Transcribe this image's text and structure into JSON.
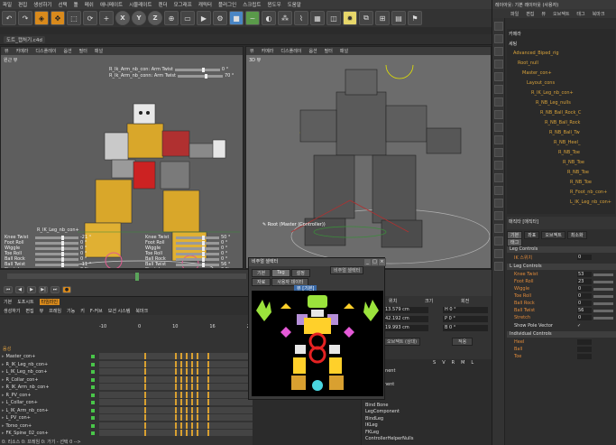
{
  "menubar": [
    "파일",
    "편집",
    "생성하기",
    "선택",
    "툴",
    "메쉬",
    "애니메이트",
    "시뮬레이트",
    "렌더",
    "모그래프",
    "캐릭터",
    "플러그인",
    "스크립트",
    "윈도우",
    "도움말"
  ],
  "toolbar": {
    "xyz": [
      "X",
      "Y",
      "Z"
    ],
    "icons": [
      "undo-icon",
      "redo-icon",
      "select-icon",
      "move-icon",
      "scale-icon",
      "rotate-icon"
    ]
  },
  "path_tab": "도트_캡처기.c4d",
  "viewport_left": {
    "menu": [
      "뷰",
      "카메라",
      "디스플레이",
      "옵션",
      "필터",
      "패널"
    ],
    "label": "원근 뷰",
    "top_controls": [
      "R_Ik_Arm_nb_con: Arm Twist",
      "R_Ik_Arm_nb_conn: Arm Twist"
    ],
    "top_values": [
      "0 °",
      "70 °"
    ],
    "bottom_header": "R_IK_Leg_nb_con+",
    "bottom_controls": [
      "Knee Twist",
      "Foot Roll",
      "Wiggle",
      "Toe Roll",
      "Ball Rock",
      "Ball Twist",
      "Stretch"
    ],
    "bottom_values": [
      "-21 °",
      "0 °",
      "0 °",
      "0 °",
      "0 °",
      "-11 °",
      "0 %"
    ],
    "bottom_controls_right": [
      "Knee Twist",
      "Foot Roll",
      "Wiggle",
      "Toe Roll",
      "Ball Rock",
      "Ball Twist",
      "Stretch"
    ],
    "bottom_values_right": [
      "50 °",
      "0 °",
      "0 °",
      "0 °",
      "0 °",
      "56 °",
      "0 %"
    ]
  },
  "viewport_right": {
    "menu": [
      "뷰",
      "카메라",
      "디스플레이",
      "옵션",
      "필터",
      "패널"
    ],
    "label": "3D 뷰",
    "tooltip": "Root (Master (Controller))"
  },
  "dopesheet": {
    "tabs": [
      "기본",
      "도프시트",
      "타임라인"
    ],
    "menu": [
      "생성하기",
      "편집",
      "뷰",
      "프레임",
      "기능",
      "키",
      "F-커브",
      "모션 시스템",
      "북마크"
    ],
    "header": "음성",
    "rows": [
      "Master_con+",
      "R_IK_Leg_nb_con+",
      "L_IK_Leg_nb_con+",
      "R_Collar_con+",
      "R_IK_Arm_nb_con+",
      "R_PV_con+",
      "L_Collar_con+",
      "L_IK_Arm_nb_con+",
      "L_PV_con+",
      "Torso_con+",
      "FK_Spine_02_con+"
    ],
    "ruler": [
      "-10",
      "0",
      "10",
      "16",
      "24"
    ],
    "status": "0: 리소스 0: 프레임 0: 가기 - 선택 0 -->"
  },
  "visual_selector": {
    "title": "비주얼 셀렉터",
    "dropdown": "비주얼 셀렉터",
    "tabs": [
      "기본",
      "Tag",
      "설정"
    ],
    "subtabs": [
      "자료",
      "사용자 데이터"
    ],
    "canvas_label": "뷰 [기본]"
  },
  "coord": {
    "labels": [
      "위치",
      "크기",
      "회전"
    ],
    "values": [
      "13.579 cm",
      "42.192 cm",
      "19.993 cm"
    ],
    "angles": [
      "H 0 °",
      "P 0 °",
      "B 0 °"
    ],
    "object_btn": "오브젝트 (상대)",
    "apply_btn": "적용"
  },
  "objlist": {
    "header": [
      "이름",
      "S",
      "V",
      "R",
      "M",
      "L"
    ],
    "rows": [
      "IkComponent",
      "Solvers",
      "nComponent",
      "Spine",
      "Root",
      "Bind Bone",
      "LegComponent",
      "BindLeg",
      "IKLeg",
      "FKLeg",
      "ControllerHelperNulls"
    ]
  },
  "right_panel": {
    "title": "레이아웃: 기본 레이아웃 (사용자)",
    "menu": [
      "파일",
      "편집",
      "뷰",
      "오브젝트",
      "태그",
      "북마크"
    ],
    "tree": [
      "카메라",
      "세팅",
      "Advanced_Biped_rig",
      "Root_null",
      "Master_con+",
      "Layout_cons",
      "R_IK_Leg_nb_con+",
      "R_NB_Leg_nulls",
      "R_NB_Ball_Rock_C",
      "R_NB_Ball_Rock",
      "R_NB_Ball_Tw",
      "R_NB_Heel_",
      "R_NB_Toe",
      "R_NB_Toe",
      "R_NB_Toe",
      "R_NB_Toe",
      "R_Foot_nb_con+",
      "L_IK_Leg_nb_con+"
    ],
    "attr_title": "매직타 [매직타]",
    "attr_tabs": [
      "기본",
      "좌표",
      "오브젝트",
      "최소화"
    ],
    "attr_subtabs": [
      "태그"
    ],
    "section_leg": "Leg Controls",
    "ik_switch_label": "IK 스위치",
    "ik_switch_value": "0",
    "section_sub": "L Leg Controls",
    "attrs": [
      "Knee Twist",
      "Foot Roll",
      "Wiggle",
      "Toe Roll",
      "Ball Rock",
      "Ball Twist",
      "Stretch"
    ],
    "attr_values": [
      "53",
      "23",
      "0",
      "0",
      "0",
      "56",
      "0"
    ],
    "show_pole": "Show Pole Vector",
    "section_ind": "Individual Controls",
    "ind": [
      "Heel",
      "Ball",
      "Toe"
    ]
  },
  "colors": {
    "accent": "#d98a1c",
    "attr_label": "#e08a3a",
    "tree_text": "#d8a23a",
    "key_color": "#d9a030"
  }
}
